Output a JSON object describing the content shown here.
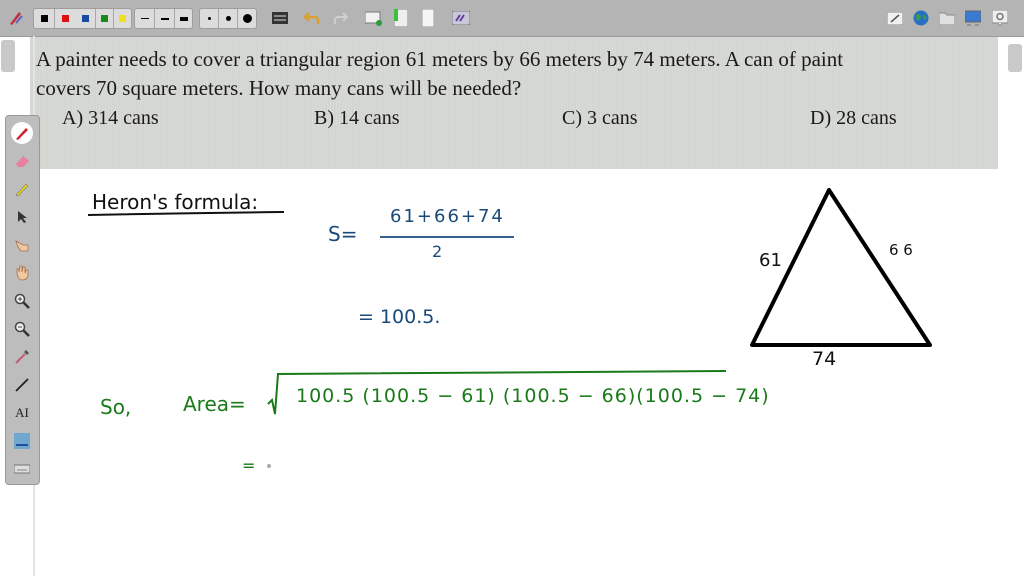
{
  "toolbar": {
    "left_icons": [
      "pen-settings-icon"
    ],
    "colors": [
      "#000000",
      "#e01010",
      "#1a4aa0",
      "#1a8a1a",
      "#f0e020"
    ],
    "line_widths": [
      "thin",
      "medium",
      "thick"
    ],
    "dot_sizes": [
      "small",
      "medium",
      "large"
    ],
    "tools": [
      "screen-capture-icon",
      "undo-icon",
      "redo-icon",
      "new-page-icon",
      "page-green-icon",
      "page-blank-icon",
      "hands-icon"
    ],
    "right_tools": [
      "whiteboard-icon",
      "globe-icon",
      "folder-icon",
      "display-icon",
      "settings-icon"
    ]
  },
  "question": {
    "text_line1": "A  painter needs to cover a triangular region 61 meters by 66 meters by 74 meters.  A can of paint",
    "text_line2": "covers 70 square meters.  How many cans will be needed?",
    "options": [
      "A) 314 cans",
      "B) 14 cans",
      "C) 3 cans",
      "D) 28 cans"
    ]
  },
  "sidebar": {
    "tools": [
      "pen-icon",
      "eraser-icon",
      "highlighter-icon",
      "pointer-icon",
      "hand-pointer-icon",
      "hand-grab-icon",
      "zoom-in-icon",
      "zoom-out-icon",
      "color-picker-icon",
      "line-icon",
      "text-icon",
      "image-icon",
      "keyboard-icon"
    ],
    "text_tool_label": "AI"
  },
  "whiteboard": {
    "heading": "Heron's formula:",
    "s_label": "S=",
    "s_numerator": "61+66+74",
    "s_denominator": "2",
    "s_result": "=  100.5.",
    "so_label": "So,",
    "area_label": "Area=",
    "area_expression": "100.5 (100.5 − 61)  (100.5 − 66)(100.5 − 74)",
    "equals_next": "=",
    "triangle": {
      "side_left": "61",
      "side_right": "6 6",
      "side_bottom": "74"
    }
  }
}
